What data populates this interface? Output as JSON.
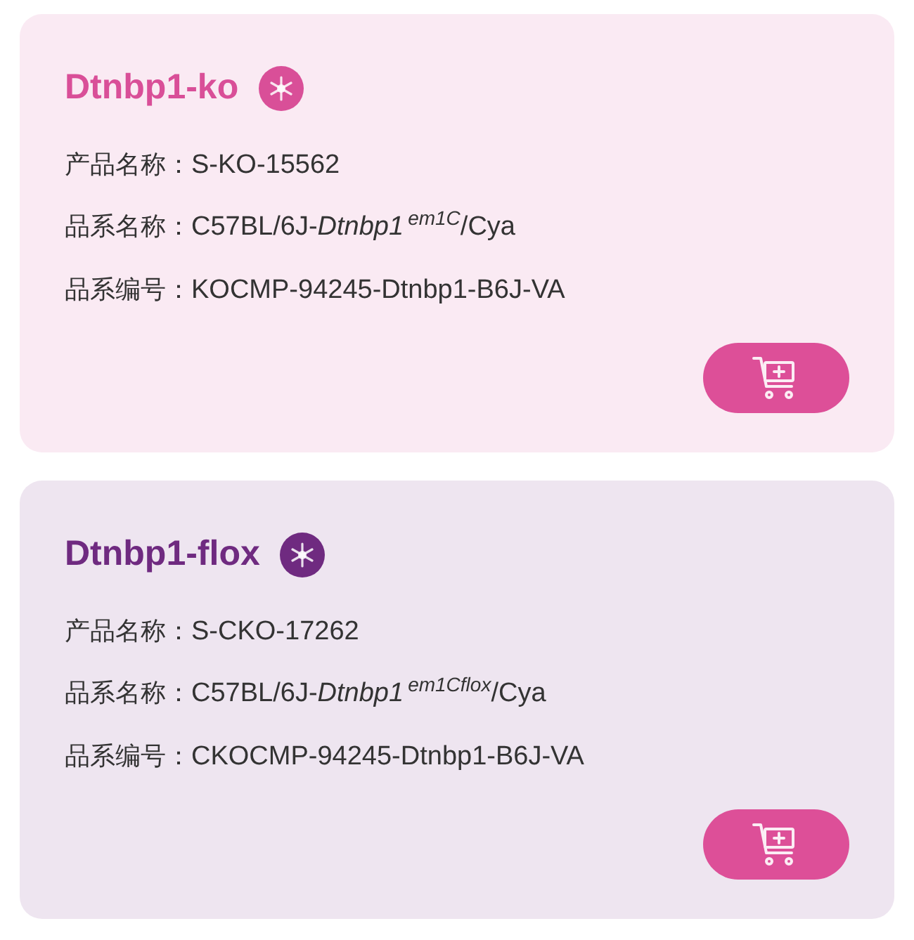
{
  "cards": [
    {
      "title": "Dtnbp1-ko",
      "color": "#d94f98",
      "fields": [
        {
          "label": "产品名称：",
          "value": "S-KO-15562"
        },
        {
          "label": "品系名称：",
          "value": "C57BL/6J-*Dtnbp1*$^{em1C}$/Cya"
        },
        {
          "label": "品系编号：",
          "value": "KOCMP-94245-Dtnbp1-B6J-VA"
        }
      ]
    },
    {
      "title": "Dtnbp1-flox",
      "color": "#6f2a80",
      "fields": [
        {
          "label": "产品名称：",
          "value": "S-CKO-17262"
        },
        {
          "label": "品系名称：",
          "value": "C57BL/6J-*Dtnbp1*$^{em1Cflox}$/Cya"
        },
        {
          "label": "品系编号：",
          "value": "CKOCMP-94245-Dtnbp1-B6J-VA"
        }
      ]
    }
  ]
}
